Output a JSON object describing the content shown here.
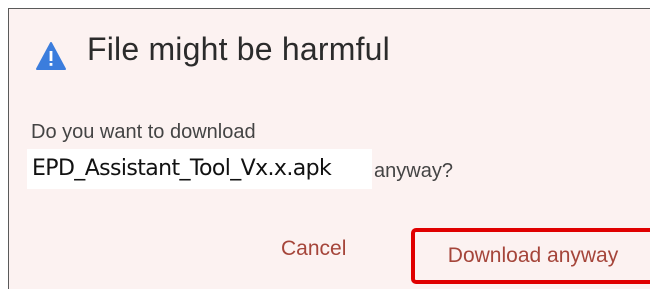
{
  "dialog": {
    "title": "File might be harmful",
    "icon": "warning-triangle-icon",
    "prompt_line1": "Do you want to download",
    "filename": "EPD_Assistant_Tool_Vx.x.apk",
    "prompt_suffix": "anyway?",
    "cancel_label": "Cancel",
    "confirm_label": "Download anyway"
  },
  "colors": {
    "dialog_background": "#fcf2f1",
    "icon_blue": "#3b7ddd",
    "button_text": "#a5453a",
    "highlight_border": "#e00000"
  }
}
